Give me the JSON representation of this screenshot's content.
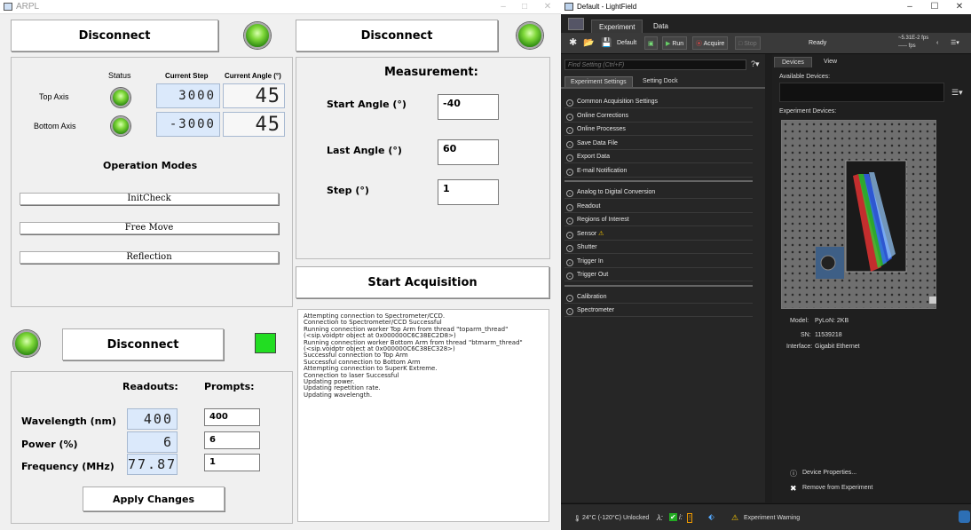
{
  "arpl": {
    "window_title": "ARPL",
    "controls": {
      "minimize": "–",
      "maximize": "□",
      "close": "✕"
    },
    "motors": {
      "disconnect_label": "Disconnect",
      "headers": {
        "status": "Status",
        "current_step": "Current Step",
        "current_angle": "Current Angle (°)"
      },
      "rows": [
        {
          "label": "Top Axis",
          "step": "3000",
          "angle": "45"
        },
        {
          "label": "Bottom Axis",
          "step": "-3000",
          "angle": "45"
        }
      ],
      "operation_modes_title": "Operation Modes",
      "modes": [
        "InitCheck",
        "Free Move",
        "Reflection"
      ]
    },
    "spectrometer": {
      "disconnect_label": "Disconnect",
      "measurement_title": "Measurement:",
      "fields": [
        {
          "label": "Start Angle (°)",
          "value": "-40"
        },
        {
          "label": "Last Angle (°)",
          "value": "60"
        },
        {
          "label": "Step (°)",
          "value": "1"
        }
      ],
      "start_acquisition_label": "Start Acquisition",
      "log": "Attempting connection to Spectrometer/CCD.\nConnection to Spectrometer/CCD Successful\nRunning connection worker Top Arm from thread \"toparm_thread\" (<sip.voidptr object at 0x000000C6C38EC2D8>)\nRunning connection worker Bottom Arm from thread \"btmarm_thread\" (<sip.voidptr object at 0x000000C6C38EC328>)\nSuccessful connection to Top Arm\nSuccessful connection to Bottom Arm\nAttempting connection to SuperK Extreme.\nConnection to laser Successful\nUpdating power.\nUpdating repetition rate.\nUpdating wavelength."
    },
    "laser": {
      "disconnect_label": "Disconnect",
      "status_color": "#22dd22",
      "readouts_header": "Readouts:",
      "prompts_header": "Prompts:",
      "rows": [
        {
          "label": "Wavelength (nm)",
          "readout": "400",
          "prompt": "400"
        },
        {
          "label": "Power (%)",
          "readout": "6",
          "prompt": "6"
        },
        {
          "label": "Frequency (MHz)",
          "readout": "77.87",
          "prompt": "1"
        }
      ],
      "apply_label": "Apply Changes"
    }
  },
  "lightfield": {
    "window_title": "Default - LightField",
    "controls": {
      "minimize": "–",
      "maximize": "☐",
      "close": "✕"
    },
    "tabs": [
      "Experiment",
      "Data"
    ],
    "toolbar": {
      "experiment_name": "Default",
      "run_label": "Run",
      "acquire_label": "Acquire",
      "stop_label": "Stop",
      "status": "Ready",
      "rate_line1": "~5.31E-2 fps",
      "rate_line2": "----- fps"
    },
    "find_placeholder": "Find Setting (Ctrl+F)",
    "settings_tabs": [
      "Experiment Settings",
      "Setting Dock"
    ],
    "settings_groups": [
      [
        "Common Acquisition Settings",
        "Online Corrections",
        "Online Processes",
        "Save Data File",
        "Export Data",
        "E-mail Notification"
      ],
      [
        "Analog to Digital Conversion",
        "Readout",
        "Regions of Interest",
        "Sensor",
        "Shutter",
        "Trigger In",
        "Trigger Out"
      ],
      [
        "Calibration",
        "Spectrometer"
      ]
    ],
    "device_tabs": [
      "Devices",
      "View"
    ],
    "available_devices_label": "Available Devices:",
    "experiment_devices_label": "Experiment Devices:",
    "device_info": {
      "model_label": "Model:",
      "model": "PyLoN: 2KB",
      "sn_label": "SN:",
      "sn": "11539218",
      "interface_label": "Interface:",
      "interface": "Gigabit Ethernet"
    },
    "device_properties_label": "Device Properties...",
    "remove_label": "Remove from Experiment",
    "status": {
      "temperature": "24°C (-120°C) Unlocked",
      "lambda": "λ:",
      "experiment_warning": "Experiment Warning"
    }
  }
}
